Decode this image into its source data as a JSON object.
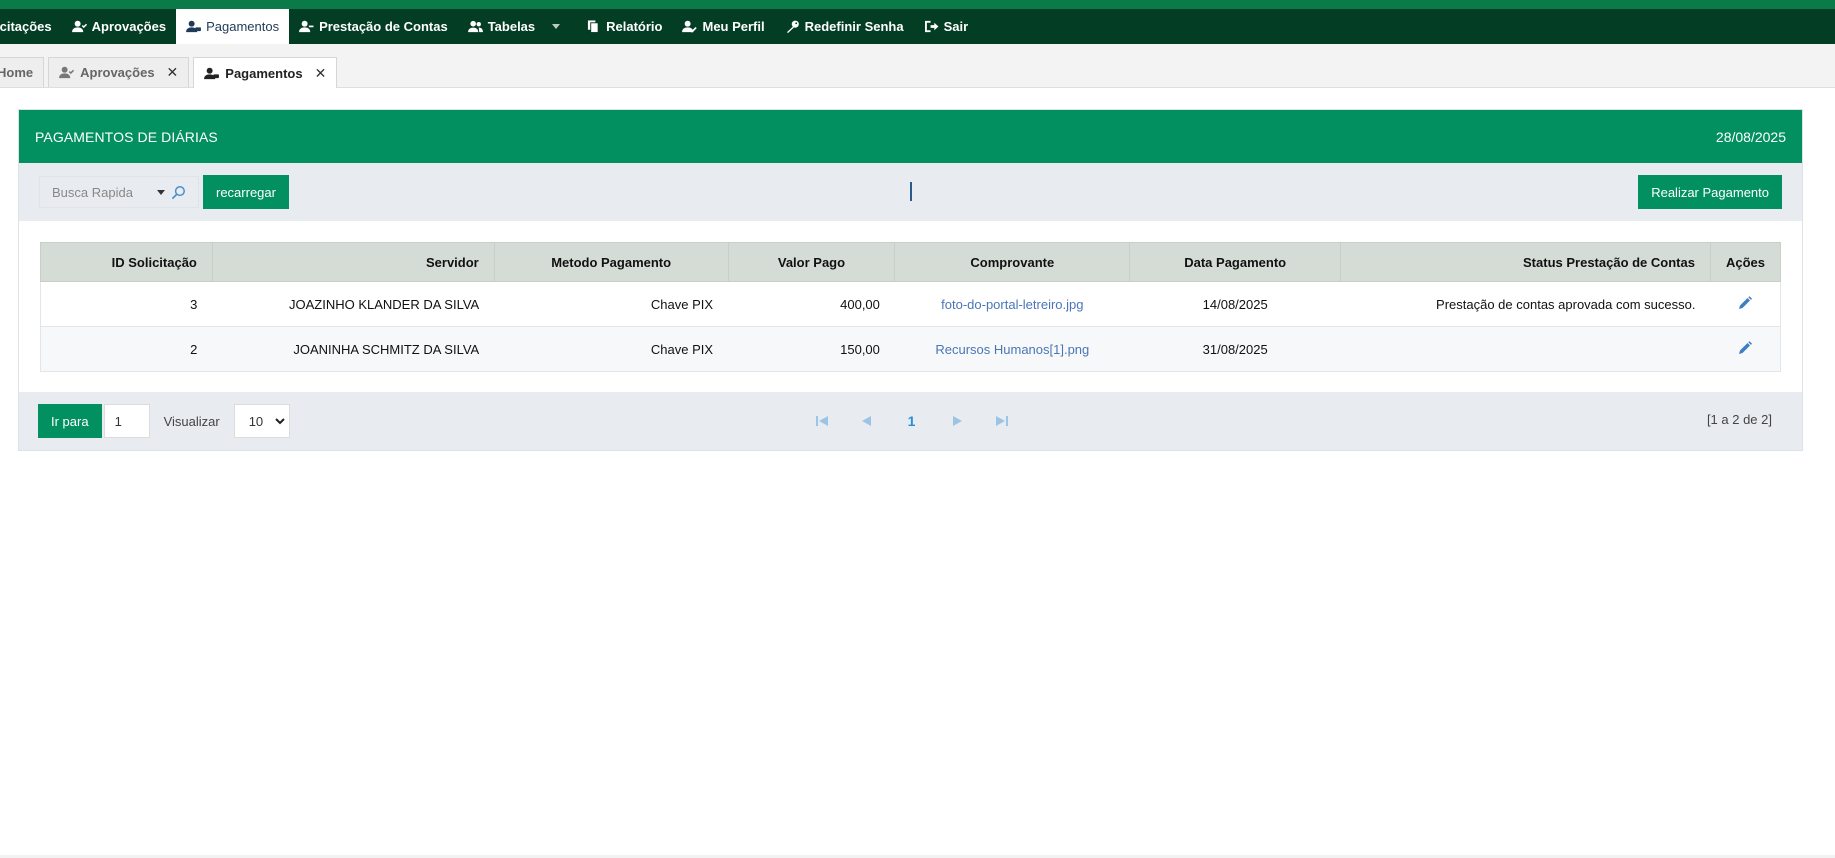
{
  "colors": {
    "brand": "#029060",
    "navbar": "#033d23",
    "link": "#4a76b8",
    "pager_active": "#2b8fd6"
  },
  "navbar": {
    "items": [
      {
        "label": "icitações",
        "icon": "none",
        "active": false
      },
      {
        "label": "Aprovações",
        "icon": "user-check-icon",
        "active": false
      },
      {
        "label": "Pagamentos",
        "icon": "user-money-icon",
        "active": true
      },
      {
        "label": "Prestação de Contas",
        "icon": "user-minus-icon",
        "active": false
      },
      {
        "label": "Tabelas",
        "icon": "users-icon",
        "active": false,
        "dropdown": true
      },
      {
        "label": "Relatório",
        "icon": "copy-icon",
        "active": false
      },
      {
        "label": "Meu Perfil",
        "icon": "user-edit-icon",
        "active": false
      },
      {
        "label": "Redefinir Senha",
        "icon": "key-icon",
        "active": false
      },
      {
        "label": "Sair",
        "icon": "sign-out-icon",
        "active": false
      }
    ]
  },
  "tabs": [
    {
      "label": "Home",
      "closable": false
    },
    {
      "label": "Aprovações",
      "closable": true,
      "close_glyph": "✕"
    },
    {
      "label": "Pagamentos",
      "closable": true,
      "close_glyph": "✕",
      "active": true
    }
  ],
  "panel": {
    "title": "PAGAMENTOS DE DIÁRIAS",
    "date": "28/08/2025"
  },
  "toolbar": {
    "search_placeholder": "Busca Rapida",
    "reload_label": "recarregar",
    "pay_label": "Realizar Pagamento"
  },
  "table": {
    "headers": [
      "ID Solicitação",
      "Servidor",
      "Metodo Pagamento",
      "Valor Pago",
      "Comprovante",
      "Data Pagamento",
      "Status Prestação de Contas",
      "Ações"
    ],
    "rows": [
      {
        "id": "3",
        "servidor": "JOAZINHO KLANDER DA SILVA",
        "metodo": "Chave PIX",
        "valor": "400,00",
        "comprovante": "foto-do-portal-letreiro.jpg",
        "data": "14/08/2025",
        "status": "Prestação de contas aprovada com sucesso."
      },
      {
        "id": "2",
        "servidor": "JOANINHA SCHMITZ DA SILVA",
        "metodo": "Chave PIX",
        "valor": "150,00",
        "comprovante": "Recursos Humanos[1].png",
        "data": "31/08/2025",
        "status": ""
      }
    ]
  },
  "footer": {
    "goto_label": "Ir para",
    "goto_value": "1",
    "view_label": "Visualizar",
    "page_size": "10",
    "current_page": "1",
    "counter": "[1 a 2 de 2]"
  }
}
